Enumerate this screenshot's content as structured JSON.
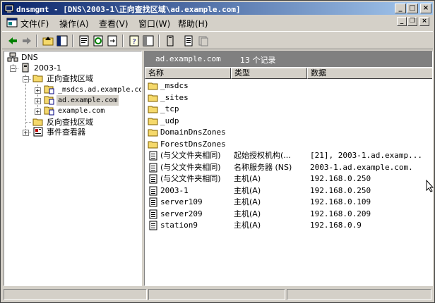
{
  "window": {
    "title": "dnsmgmt - [DNS\\2003-1\\正向查找区域\\ad.example.com]",
    "buttons": {
      "minimize": "_",
      "maximize": "□",
      "close": "×"
    }
  },
  "menu": {
    "items": [
      "文件(F)",
      "操作(A)",
      "查看(V)",
      "窗口(W)",
      "帮助(H)"
    ],
    "mdi_buttons": {
      "minimize": "_",
      "restore": "❐",
      "close": "×"
    }
  },
  "toolbar": {
    "icons": [
      "back-icon",
      "forward-icon",
      "up-icon",
      "show-tree-icon",
      "properties-icon",
      "refresh-icon",
      "export-list-icon",
      "help-icon",
      "console-tree-icon",
      "new-host-icon",
      "new-alias-icon",
      "new-mail-exchanger-icon"
    ]
  },
  "tree": {
    "root": "DNS",
    "server": "2003-1",
    "forward_zones": "正向查找区域",
    "zones": [
      "_msdcs.ad.example.com",
      "ad.example.com",
      "example.com"
    ],
    "reverse_zones": "反向查找区域",
    "event_viewer": "事件查看器"
  },
  "details": {
    "zone_name": "ad.example.com",
    "record_count": "13 个记录",
    "columns": [
      "名称",
      "类型",
      "数据"
    ],
    "rows": [
      {
        "name": "_msdcs",
        "type": "",
        "data": "",
        "icon": "folder"
      },
      {
        "name": "_sites",
        "type": "",
        "data": "",
        "icon": "folder"
      },
      {
        "name": "_tcp",
        "type": "",
        "data": "",
        "icon": "folder"
      },
      {
        "name": "_udp",
        "type": "",
        "data": "",
        "icon": "folder"
      },
      {
        "name": "DomainDnsZones",
        "type": "",
        "data": "",
        "icon": "folder"
      },
      {
        "name": "ForestDnsZones",
        "type": "",
        "data": "",
        "icon": "folder"
      },
      {
        "name": "(与父文件夹相同)",
        "type": "起始授权机构(...",
        "data": "[21], 2003-1.ad.examp...",
        "icon": "record"
      },
      {
        "name": "(与父文件夹相同)",
        "type": "名称服务器 (NS)",
        "data": "2003-1.ad.example.com.",
        "icon": "record"
      },
      {
        "name": "(与父文件夹相同)",
        "type": "主机(A)",
        "data": "192.168.0.250",
        "icon": "record"
      },
      {
        "name": "2003-1",
        "type": "主机(A)",
        "data": "192.168.0.250",
        "icon": "record"
      },
      {
        "name": "server109",
        "type": "主机(A)",
        "data": "192.168.0.109",
        "icon": "record"
      },
      {
        "name": "server209",
        "type": "主机(A)",
        "data": "192.168.0.209",
        "icon": "record"
      },
      {
        "name": "station9",
        "type": "主机(A)",
        "data": "192.168.0.9",
        "icon": "record"
      }
    ]
  },
  "colors": {
    "title_start": "#0a246a",
    "title_end": "#a6caf0",
    "chrome": "#d4d0c8",
    "header_gray": "#808080",
    "folder_yellow": "#f5d96b"
  }
}
